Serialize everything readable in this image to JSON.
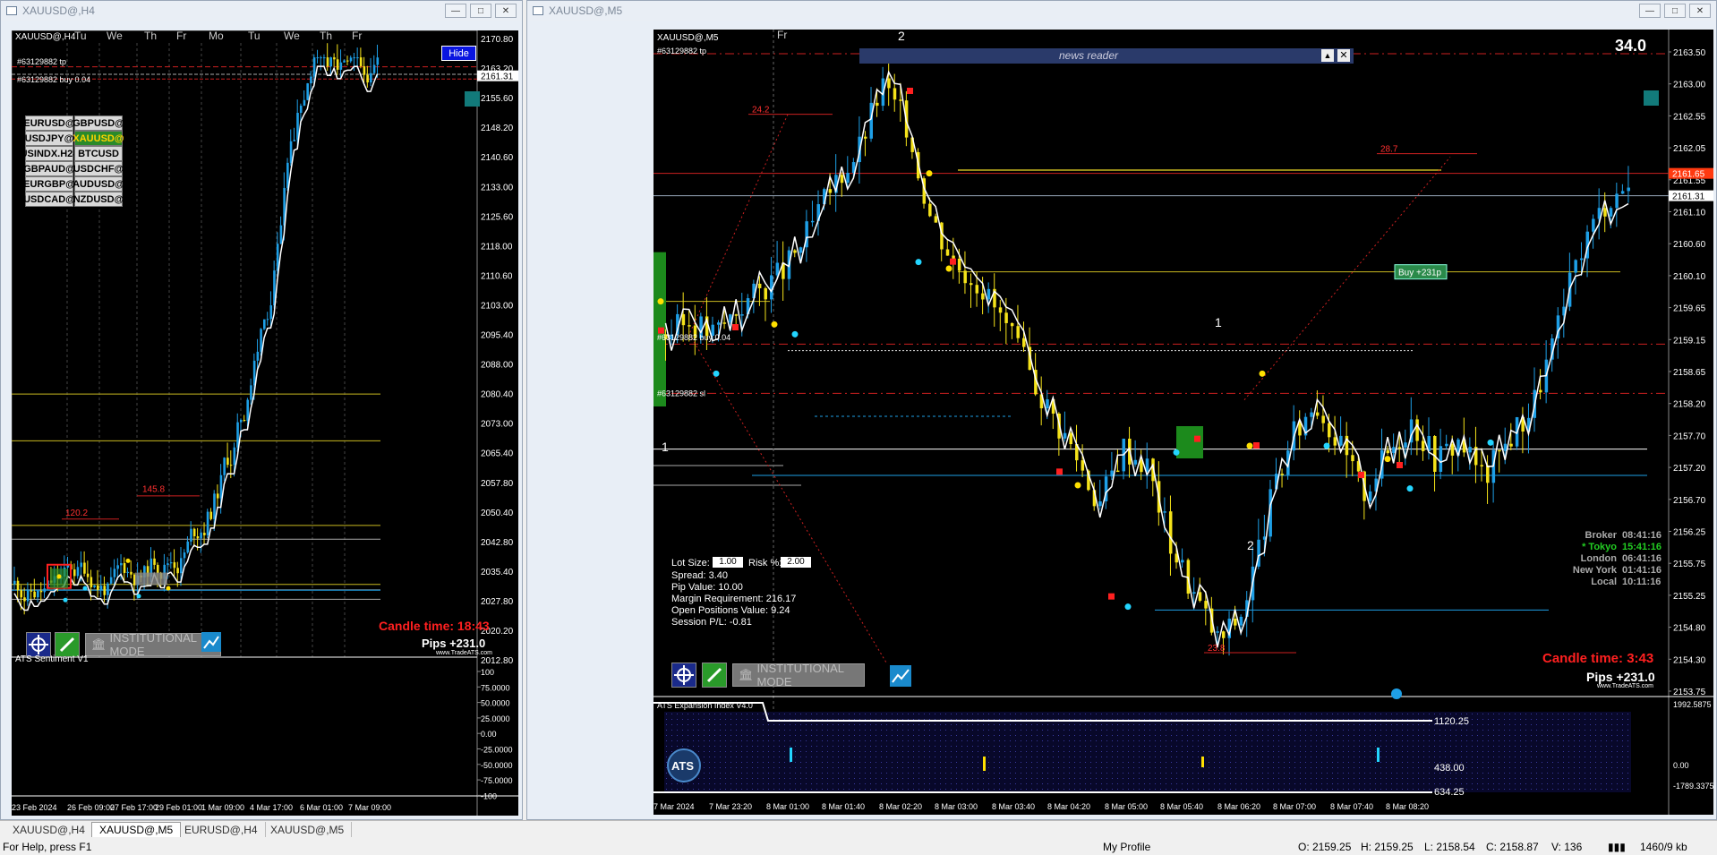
{
  "left_window": {
    "title": "XAUUSD@,H4",
    "chart_label": "XAUUSD@,H4",
    "hide_button": "Hide",
    "tp_label": "#63129882 tp",
    "buy_label": "#63129882 buy 0.04",
    "day_labels": [
      "Tu",
      "We",
      "Th",
      "Fr",
      "Mo",
      "Tu",
      "We",
      "Th",
      "Fr"
    ],
    "price_ticks": [
      "2170.80",
      "2163.20",
      "2155.60",
      "2148.20",
      "2140.60",
      "2133.00",
      "2125.60",
      "2118.00",
      "2110.60",
      "2103.00",
      "2095.40",
      "2088.00",
      "2080.40",
      "2073.00",
      "2065.40",
      "2057.80",
      "2050.40",
      "2042.80",
      "2035.40",
      "2027.80",
      "2020.20",
      "2012.80"
    ],
    "current_price_tag": "2161.31",
    "pairs": [
      {
        "label": "EURUSD@",
        "active": false
      },
      {
        "label": "GBPUSD@",
        "active": false
      },
      {
        "label": "USDJPY@",
        "active": false
      },
      {
        "label": "XAUUSD@",
        "active": true
      },
      {
        "label": "USINDX.H24",
        "active": false
      },
      {
        "label": "BTCUSD",
        "active": false
      },
      {
        "label": "GBPAUD@",
        "active": false
      },
      {
        "label": "USDCHF@",
        "active": false
      },
      {
        "label": "EURGBP@",
        "active": false
      },
      {
        "label": "AUDUSD@",
        "active": false
      },
      {
        "label": "USDCAD@",
        "active": false
      },
      {
        "label": "NZDUSD@",
        "active": false
      }
    ],
    "annotations": [
      "120.2",
      "145.8"
    ],
    "candle_time_label": "Candle time:",
    "candle_time_value": "18:43",
    "pips_label": "Pips +231.0",
    "website": "www.TradeATS.com",
    "institutional_mode": "INSTITUTIONAL MODE",
    "indicator_name": "ATS Sentiment V1",
    "indicator_ticks": [
      "100",
      "75.0000",
      "50.0000",
      "25.0000",
      "0.00",
      "-25.0000",
      "-50.0000",
      "-75.0000",
      "-100"
    ],
    "date_ticks": [
      "23 Feb 2024",
      "26 Feb 09:00",
      "27 Feb 17:00",
      "29 Feb 01:00",
      "1 Mar 09:00",
      "4 Mar 17:00",
      "6 Mar 01:00",
      "7 Mar 09:00"
    ]
  },
  "right_window": {
    "title": "XAUUSD@,M5",
    "chart_label": "XAUUSD@,M5",
    "day_label": "Fr",
    "tp_label": "#63129882 tp",
    "buy_label": "#63129882 buy 0.04",
    "sl_label": "#63129882 sl",
    "news_reader": "news reader",
    "spread_big": "34.0",
    "price_ticks": [
      "2163.50",
      "2163.00",
      "2162.55",
      "2162.05",
      "2161.55",
      "2161.10",
      "2160.60",
      "2160.10",
      "2159.65",
      "2159.15",
      "2158.65",
      "2158.20",
      "2157.70",
      "2157.20",
      "2156.70",
      "2156.25",
      "2155.75",
      "2155.25",
      "2154.80",
      "2154.30",
      "2153.75"
    ],
    "ask_tag": "2161.65",
    "bid_tag": "2161.31",
    "buy_badge": "Buy +231p",
    "annotations": [
      "24.2",
      "28.7",
      "23.8"
    ],
    "wave_labels": [
      "2",
      "1",
      "1",
      "2"
    ],
    "lot_size_label": "Lot Size:",
    "lot_size_value": "1.00",
    "risk_label": "Risk %:",
    "risk_value": "2.00",
    "info_lines": [
      "Spread: 3.40",
      "Pip Value: 10.00",
      "Margin Requirement: 216.17",
      "Open Positions Value: 9.24",
      "Session P/L: -0.81"
    ],
    "clocks": [
      {
        "name": "Broker",
        "time": "08:41:16",
        "color": "#aaaaaa"
      },
      {
        "name": "* Tokyo",
        "time": "15:41:16",
        "color": "#22cc22"
      },
      {
        "name": "London",
        "time": "06:41:16",
        "color": "#aaaaaa"
      },
      {
        "name": "New York",
        "time": "01:41:16",
        "color": "#aaaaaa"
      },
      {
        "name": "Local",
        "time": "10:11:16",
        "color": "#aaaaaa"
      }
    ],
    "candle_time_label": "Candle time:",
    "candle_time_value": "3:43",
    "pips_label": "Pips +231.0",
    "website": "www.TradeATS.com",
    "institutional_mode": "INSTITUTIONAL MODE",
    "indicator_name": "ATS Expansion Index V4.0",
    "indicator_top": "1992.5875",
    "indicator_zero": "0.00",
    "indicator_bottom": "-1789.3375",
    "indicator_labels": [
      "1120.25",
      "438.00",
      "634.25"
    ],
    "ats_logo": "ATS",
    "date_ticks": [
      "7 Mar 2024",
      "7 Mar 23:20",
      "8 Mar 01:00",
      "8 Mar 01:40",
      "8 Mar 02:20",
      "8 Mar 03:00",
      "8 Mar 03:40",
      "8 Mar 04:20",
      "8 Mar 05:00",
      "8 Mar 05:40",
      "8 Mar 06:20",
      "8 Mar 07:00",
      "8 Mar 07:40",
      "8 Mar 08:20"
    ]
  },
  "tabs": [
    {
      "label": "XAUUSD@,H4",
      "active": false
    },
    {
      "label": "XAUUSD@,M5",
      "active": true
    },
    {
      "label": "EURUSD@,H4",
      "active": false
    },
    {
      "label": "XAUUSD@,M5",
      "active": false
    }
  ],
  "status": {
    "help": "For Help, press F1",
    "profile": "My Profile",
    "open": "O: 2159.25",
    "high": "H: 2159.25",
    "low": "L: 2158.54",
    "close": "C: 2158.87",
    "volume": "V: 136",
    "traffic": "1460/9 kb"
  },
  "colors": {
    "bull": "#1e9fe6",
    "bear": "#f5e31a",
    "chart_bg": "#000000",
    "loss_red": "#ff2020",
    "grid": "#555555"
  }
}
